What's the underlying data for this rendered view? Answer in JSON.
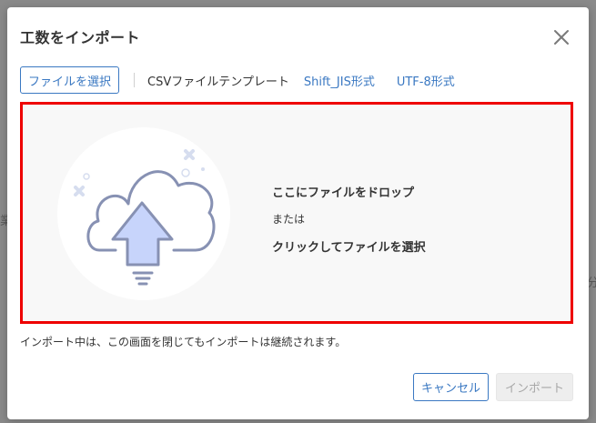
{
  "background": {
    "left_fragment": "業",
    "right_fragment": "分"
  },
  "modal": {
    "title": "工数をインポート",
    "close_icon": "close-icon",
    "toolbar": {
      "select_file_label": "ファイルを選択",
      "template_label": "CSVファイルテンプレート",
      "template_links": [
        "Shift_JIS形式",
        "UTF-8形式"
      ]
    },
    "dropzone": {
      "illustration_icon": "cloud-upload-icon",
      "line1": "ここにファイルをドロップ",
      "line2": "または",
      "line3": "クリックしてファイルを選択",
      "highlight_color": "#ee0000"
    },
    "note": "インポート中は、この画面を閉じてもインポートは継続されます。",
    "footer": {
      "cancel_label": "キャンセル",
      "import_label": "インポート"
    }
  },
  "colors": {
    "accent": "#3a78c2",
    "disabled_bg": "#eeeeee",
    "disabled_text": "#a8a8a8"
  }
}
